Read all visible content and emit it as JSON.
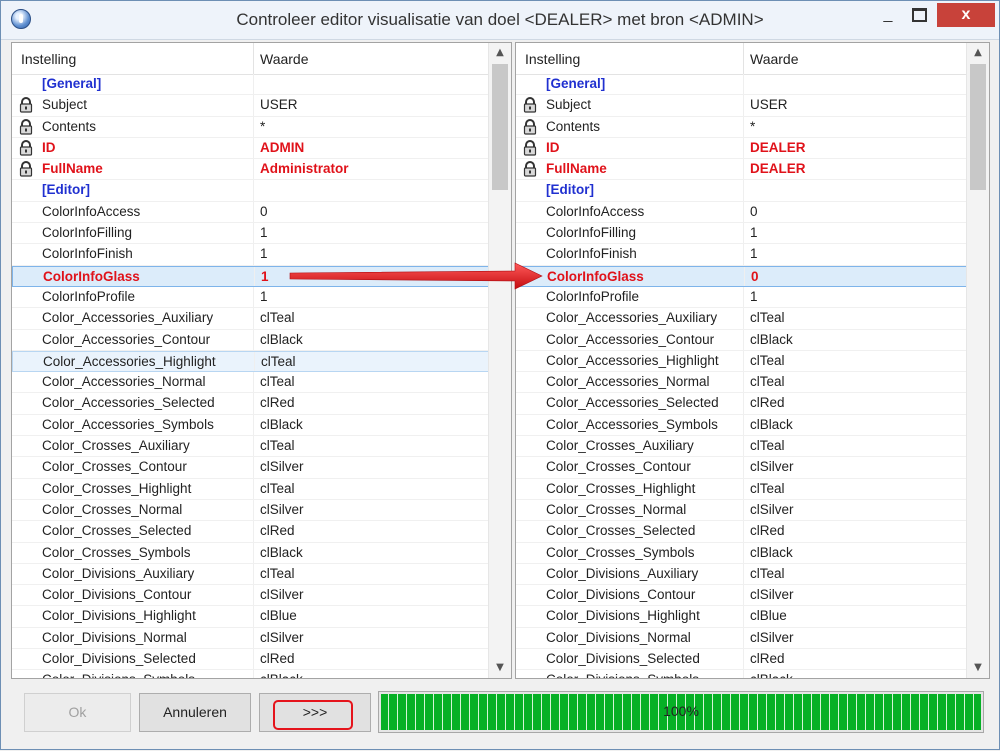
{
  "window": {
    "title": "Controleer editor visualisatie van doel <DEALER> met bron <ADMIN>",
    "minimize": "_",
    "close": "x"
  },
  "columns": {
    "setting": "Instelling",
    "value": "Waarde"
  },
  "left_rows": [
    {
      "name": "[General]",
      "value": "",
      "kind": "section"
    },
    {
      "name": "Subject",
      "value": "USER",
      "kind": "locked"
    },
    {
      "name": "Contents",
      "value": "*",
      "kind": "locked"
    },
    {
      "name": "ID",
      "value": "ADMIN",
      "kind": "locked-diff"
    },
    {
      "name": "FullName",
      "value": "Administrator",
      "kind": "locked-diff"
    },
    {
      "name": "[Editor]",
      "value": "",
      "kind": "section"
    },
    {
      "name": "ColorInfoAccess",
      "value": "0",
      "kind": ""
    },
    {
      "name": "ColorInfoFilling",
      "value": "1",
      "kind": ""
    },
    {
      "name": "ColorInfoFinish",
      "value": "1",
      "kind": ""
    },
    {
      "name": "ColorInfoGlass",
      "value": "1",
      "kind": "diff-selected"
    },
    {
      "name": "ColorInfoProfile",
      "value": "1",
      "kind": ""
    },
    {
      "name": "Color_Accessories_Auxiliary",
      "value": "clTeal",
      "kind": ""
    },
    {
      "name": "Color_Accessories_Contour",
      "value": "clBlack",
      "kind": ""
    },
    {
      "name": "Color_Accessories_Highlight",
      "value": "clTeal",
      "kind": "hover"
    },
    {
      "name": "Color_Accessories_Normal",
      "value": "clTeal",
      "kind": ""
    },
    {
      "name": "Color_Accessories_Selected",
      "value": "clRed",
      "kind": ""
    },
    {
      "name": "Color_Accessories_Symbols",
      "value": "clBlack",
      "kind": ""
    },
    {
      "name": "Color_Crosses_Auxiliary",
      "value": "clTeal",
      "kind": ""
    },
    {
      "name": "Color_Crosses_Contour",
      "value": "clSilver",
      "kind": ""
    },
    {
      "name": "Color_Crosses_Highlight",
      "value": "clTeal",
      "kind": ""
    },
    {
      "name": "Color_Crosses_Normal",
      "value": "clSilver",
      "kind": ""
    },
    {
      "name": "Color_Crosses_Selected",
      "value": "clRed",
      "kind": ""
    },
    {
      "name": "Color_Crosses_Symbols",
      "value": "clBlack",
      "kind": ""
    },
    {
      "name": "Color_Divisions_Auxiliary",
      "value": "clTeal",
      "kind": ""
    },
    {
      "name": "Color_Divisions_Contour",
      "value": "clSilver",
      "kind": ""
    },
    {
      "name": "Color_Divisions_Highlight",
      "value": "clBlue",
      "kind": ""
    },
    {
      "name": "Color_Divisions_Normal",
      "value": "clSilver",
      "kind": ""
    },
    {
      "name": "Color_Divisions_Selected",
      "value": "clRed",
      "kind": ""
    },
    {
      "name": "Color_Divisions_Symbols",
      "value": "clBlack",
      "kind": ""
    }
  ],
  "right_rows": [
    {
      "name": "[General]",
      "value": "",
      "kind": "section"
    },
    {
      "name": "Subject",
      "value": "USER",
      "kind": "locked"
    },
    {
      "name": "Contents",
      "value": "*",
      "kind": "locked"
    },
    {
      "name": "ID",
      "value": "DEALER",
      "kind": "locked-diff"
    },
    {
      "name": "FullName",
      "value": "DEALER",
      "kind": "locked-diff"
    },
    {
      "name": "[Editor]",
      "value": "",
      "kind": "section"
    },
    {
      "name": "ColorInfoAccess",
      "value": "0",
      "kind": ""
    },
    {
      "name": "ColorInfoFilling",
      "value": "1",
      "kind": ""
    },
    {
      "name": "ColorInfoFinish",
      "value": "1",
      "kind": ""
    },
    {
      "name": "ColorInfoGlass",
      "value": "0",
      "kind": "diff-selected"
    },
    {
      "name": "ColorInfoProfile",
      "value": "1",
      "kind": ""
    },
    {
      "name": "Color_Accessories_Auxiliary",
      "value": "clTeal",
      "kind": ""
    },
    {
      "name": "Color_Accessories_Contour",
      "value": "clBlack",
      "kind": ""
    },
    {
      "name": "Color_Accessories_Highlight",
      "value": "clTeal",
      "kind": ""
    },
    {
      "name": "Color_Accessories_Normal",
      "value": "clTeal",
      "kind": ""
    },
    {
      "name": "Color_Accessories_Selected",
      "value": "clRed",
      "kind": ""
    },
    {
      "name": "Color_Accessories_Symbols",
      "value": "clBlack",
      "kind": ""
    },
    {
      "name": "Color_Crosses_Auxiliary",
      "value": "clTeal",
      "kind": ""
    },
    {
      "name": "Color_Crosses_Contour",
      "value": "clSilver",
      "kind": ""
    },
    {
      "name": "Color_Crosses_Highlight",
      "value": "clTeal",
      "kind": ""
    },
    {
      "name": "Color_Crosses_Normal",
      "value": "clSilver",
      "kind": ""
    },
    {
      "name": "Color_Crosses_Selected",
      "value": "clRed",
      "kind": ""
    },
    {
      "name": "Color_Crosses_Symbols",
      "value": "clBlack",
      "kind": ""
    },
    {
      "name": "Color_Divisions_Auxiliary",
      "value": "clTeal",
      "kind": ""
    },
    {
      "name": "Color_Divisions_Contour",
      "value": "clSilver",
      "kind": ""
    },
    {
      "name": "Color_Divisions_Highlight",
      "value": "clBlue",
      "kind": ""
    },
    {
      "name": "Color_Divisions_Normal",
      "value": "clSilver",
      "kind": ""
    },
    {
      "name": "Color_Divisions_Selected",
      "value": "clRed",
      "kind": ""
    },
    {
      "name": "Color_Divisions_Symbols",
      "value": "clBlack",
      "kind": ""
    }
  ],
  "buttons": {
    "ok": "Ok",
    "cancel": "Annuleren",
    "copy": ">>>"
  },
  "progress": {
    "label": "100%",
    "value": 1.0
  },
  "colors": {
    "diff": "#e0121a",
    "section": "#2030d0",
    "progress": "#06b025",
    "arrow": "#e5141c"
  },
  "icons": {
    "lock": "padlock-icon",
    "scroll_up": "scroll-up-arrow-icon",
    "scroll_down": "scroll-down-arrow-icon"
  }
}
